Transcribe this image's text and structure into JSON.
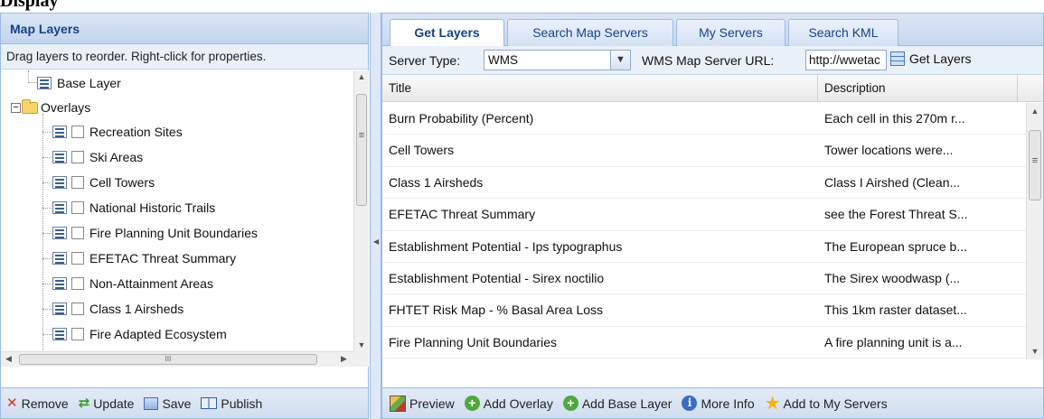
{
  "page": {
    "heading": "Display"
  },
  "left_panel": {
    "title": "Map Layers",
    "instructions": "Drag layers to reorder. Right-click for properties.",
    "tree": {
      "base_layer": "Base Layer",
      "overlays_folder": "Overlays",
      "overlays": [
        "Recreation Sites",
        "Ski Areas",
        "Cell Towers",
        "National Historic Trails",
        "Fire Planning Unit Boundaries",
        "EFETAC Threat Summary",
        "Non-Attainment Areas",
        "Class 1 Airsheds",
        "Fire Adapted Ecosystem"
      ]
    },
    "toolbar": {
      "remove": "Remove",
      "update": "Update",
      "save": "Save",
      "publish": "Publish"
    }
  },
  "right_panel": {
    "tabs": [
      {
        "label": "Get Layers",
        "active": true
      },
      {
        "label": "Search Map Servers",
        "active": false
      },
      {
        "label": "My Servers",
        "active": false
      },
      {
        "label": "Search KML",
        "active": false
      }
    ],
    "server_bar": {
      "server_type_label": "Server Type:",
      "server_type_value": "WMS",
      "url_label": "WMS Map Server URL:",
      "url_value": "http://wwetac",
      "get_layers": "Get Layers"
    },
    "grid": {
      "columns": [
        "Title",
        "Description"
      ],
      "rows": [
        [
          "Burn Probability (Percent)",
          "Each cell in this 270m r..."
        ],
        [
          "Cell Towers",
          "Tower locations were..."
        ],
        [
          "Class 1 Airsheds",
          "Class I Airshed (Clean..."
        ],
        [
          "EFETAC Threat Summary",
          "see the Forest Threat S..."
        ],
        [
          "Establishment Potential - Ips typographus",
          "The European spruce b..."
        ],
        [
          "Establishment Potential - Sirex noctilio",
          "The Sirex woodwasp (..."
        ],
        [
          "FHTET Risk Map - % Basal Area Loss",
          "This 1km raster dataset..."
        ],
        [
          "Fire Planning Unit Boundaries",
          "A fire planning unit is a..."
        ]
      ]
    },
    "toolbar": {
      "preview": "Preview",
      "add_overlay": "Add Overlay",
      "add_base_layer": "Add Base Layer",
      "more_info": "More Info",
      "add_to_my_servers": "Add to My Servers"
    }
  }
}
